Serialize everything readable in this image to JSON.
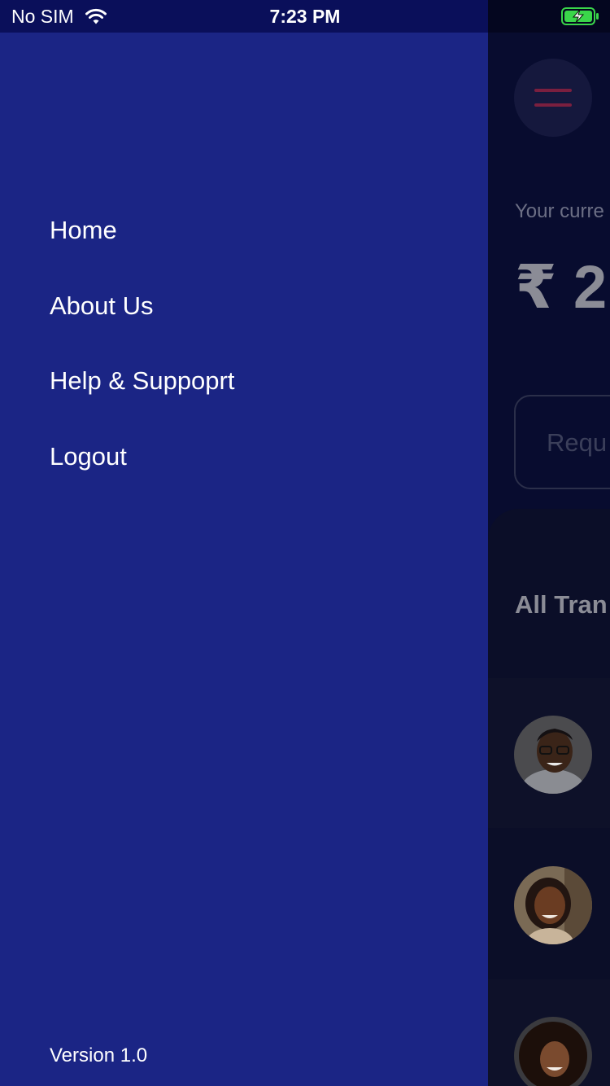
{
  "status_bar": {
    "carrier": "No SIM",
    "time": "7:23 PM",
    "wifi_icon": "wifi-icon",
    "battery_icon": "battery-charging-icon",
    "battery_color": "#3ad64a"
  },
  "drawer": {
    "background_color": "#1b2585",
    "items": [
      {
        "label": "Home"
      },
      {
        "label": "About Us"
      },
      {
        "label": "Help & Suppoprt"
      },
      {
        "label": "Logout"
      }
    ],
    "version": "Version 1.0"
  },
  "home": {
    "menu_icon": "hamburger-menu-icon",
    "menu_icon_color": "#7a1f3f",
    "balance_label": "Your curre",
    "balance_value": "₹ 2",
    "request_button_label": "Requ",
    "transactions_title": "All Tran",
    "transactions": [
      {
        "avatar": "avatar-man-glasses"
      },
      {
        "avatar": "avatar-woman-smiling"
      },
      {
        "avatar": "avatar-woman-curly-hair"
      }
    ]
  }
}
